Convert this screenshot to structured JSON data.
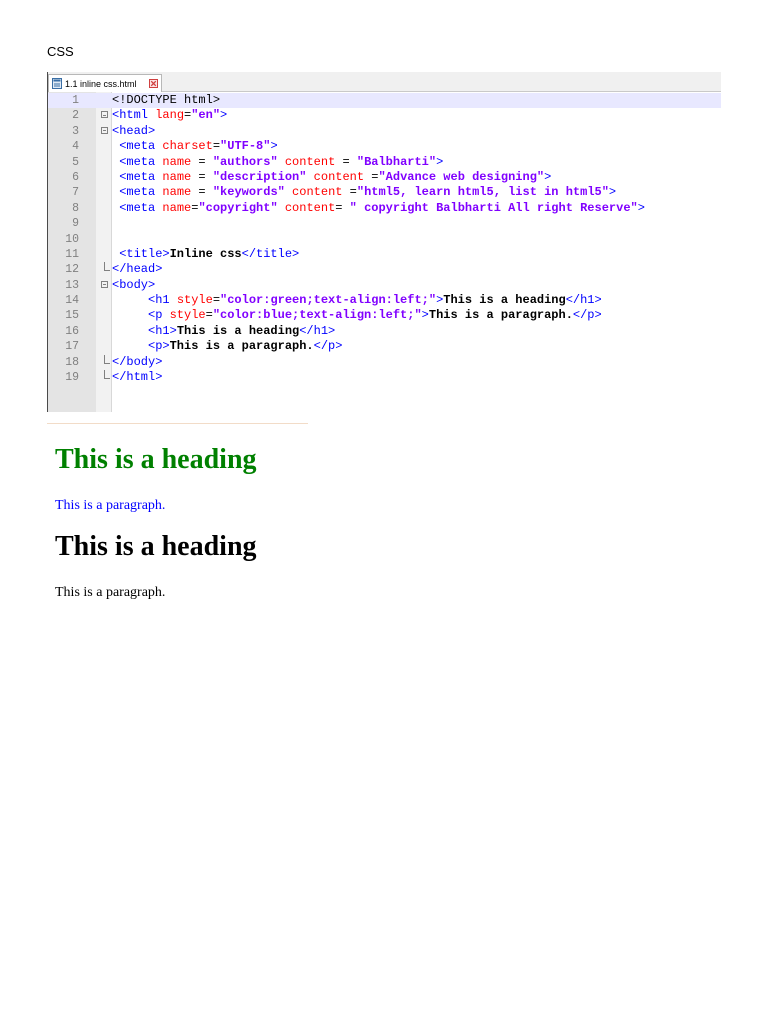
{
  "page_title": "CSS",
  "editor": {
    "tab_label": "1.1 inline css.html",
    "lines": [
      {
        "n": "1",
        "fold": "",
        "segs": [
          {
            "c": "p",
            "t": "<!DOCTYPE html>"
          }
        ]
      },
      {
        "n": "2",
        "fold": "box",
        "segs": [
          {
            "c": "t",
            "t": "<html "
          },
          {
            "c": "a",
            "t": "lang"
          },
          {
            "c": "p",
            "t": "="
          },
          {
            "c": "s",
            "t": "\"en\""
          },
          {
            "c": "t",
            "t": ">"
          }
        ]
      },
      {
        "n": "3",
        "fold": "box",
        "segs": [
          {
            "c": "t",
            "t": "<head>"
          }
        ]
      },
      {
        "n": "4",
        "fold": "",
        "segs": [
          {
            "c": "t",
            "t": " <meta "
          },
          {
            "c": "a",
            "t": "charset"
          },
          {
            "c": "p",
            "t": "="
          },
          {
            "c": "s",
            "t": "\"UTF-8\""
          },
          {
            "c": "t",
            "t": ">"
          }
        ]
      },
      {
        "n": "5",
        "fold": "",
        "segs": [
          {
            "c": "t",
            "t": " <meta "
          },
          {
            "c": "a",
            "t": "name"
          },
          {
            "c": "p",
            "t": " = "
          },
          {
            "c": "s",
            "t": "\"authors\""
          },
          {
            "c": "a",
            "t": " content"
          },
          {
            "c": "p",
            "t": " = "
          },
          {
            "c": "s",
            "t": "\"Balbharti\""
          },
          {
            "c": "t",
            "t": ">"
          }
        ]
      },
      {
        "n": "6",
        "fold": "",
        "segs": [
          {
            "c": "t",
            "t": " <meta "
          },
          {
            "c": "a",
            "t": "name"
          },
          {
            "c": "p",
            "t": " = "
          },
          {
            "c": "s",
            "t": "\"description\""
          },
          {
            "c": "a",
            "t": " content"
          },
          {
            "c": "p",
            "t": " ="
          },
          {
            "c": "s",
            "t": "\"Advance web designing\""
          },
          {
            "c": "t",
            "t": ">"
          }
        ]
      },
      {
        "n": "7",
        "fold": "",
        "segs": [
          {
            "c": "t",
            "t": " <meta "
          },
          {
            "c": "a",
            "t": "name"
          },
          {
            "c": "p",
            "t": " = "
          },
          {
            "c": "s",
            "t": "\"keywords\""
          },
          {
            "c": "a",
            "t": " content"
          },
          {
            "c": "p",
            "t": " ="
          },
          {
            "c": "s",
            "t": "\"html5, learn html5, list in html5\""
          },
          {
            "c": "t",
            "t": ">"
          }
        ]
      },
      {
        "n": "8",
        "fold": "",
        "segs": [
          {
            "c": "t",
            "t": " <meta "
          },
          {
            "c": "a",
            "t": "name"
          },
          {
            "c": "p",
            "t": "="
          },
          {
            "c": "s",
            "t": "\"copyright\""
          },
          {
            "c": "a",
            "t": " content"
          },
          {
            "c": "p",
            "t": "= "
          },
          {
            "c": "s",
            "t": "\" copyright Balbharti All right Reserve\""
          },
          {
            "c": "t",
            "t": ">"
          }
        ]
      },
      {
        "n": "9",
        "fold": "",
        "segs": []
      },
      {
        "n": "10",
        "fold": "",
        "segs": []
      },
      {
        "n": "11",
        "fold": "",
        "segs": [
          {
            "c": "t",
            "t": " <title>"
          },
          {
            "c": "x",
            "t": "Inline css"
          },
          {
            "c": "t",
            "t": "</title>"
          }
        ]
      },
      {
        "n": "12",
        "fold": "end",
        "segs": [
          {
            "c": "t",
            "t": "</head>"
          }
        ]
      },
      {
        "n": "13",
        "fold": "box",
        "segs": [
          {
            "c": "t",
            "t": "<body>"
          }
        ]
      },
      {
        "n": "14",
        "fold": "",
        "segs": [
          {
            "c": "t",
            "t": "     <h1 "
          },
          {
            "c": "a",
            "t": "style"
          },
          {
            "c": "p",
            "t": "="
          },
          {
            "c": "s",
            "t": "\"color:green;text-align:left;\""
          },
          {
            "c": "t",
            "t": ">"
          },
          {
            "c": "x",
            "t": "This is a heading"
          },
          {
            "c": "t",
            "t": "</h1>"
          }
        ]
      },
      {
        "n": "15",
        "fold": "",
        "segs": [
          {
            "c": "t",
            "t": "     <p "
          },
          {
            "c": "a",
            "t": "style"
          },
          {
            "c": "p",
            "t": "="
          },
          {
            "c": "s",
            "t": "\"color:blue;text-align:left;\""
          },
          {
            "c": "t",
            "t": ">"
          },
          {
            "c": "x",
            "t": "This is a paragraph."
          },
          {
            "c": "t",
            "t": "</p>"
          }
        ]
      },
      {
        "n": "16",
        "fold": "",
        "segs": [
          {
            "c": "t",
            "t": "     <h1>"
          },
          {
            "c": "x",
            "t": "This is a heading"
          },
          {
            "c": "t",
            "t": "</h1>"
          }
        ]
      },
      {
        "n": "17",
        "fold": "",
        "segs": [
          {
            "c": "t",
            "t": "     <p>"
          },
          {
            "c": "x",
            "t": "This is a paragraph."
          },
          {
            "c": "t",
            "t": "</p>"
          }
        ]
      },
      {
        "n": "18",
        "fold": "end",
        "segs": [
          {
            "c": "t",
            "t": "</body>"
          }
        ]
      },
      {
        "n": "19",
        "fold": "end",
        "segs": [
          {
            "c": "t",
            "t": "</html>"
          }
        ]
      }
    ]
  },
  "preview": {
    "heading1": "This is a heading",
    "heading1_color": "#008000",
    "para1": "This is a paragraph.",
    "para1_color": "#0000ff",
    "heading2": "This is a heading",
    "para2": "This is a paragraph."
  }
}
